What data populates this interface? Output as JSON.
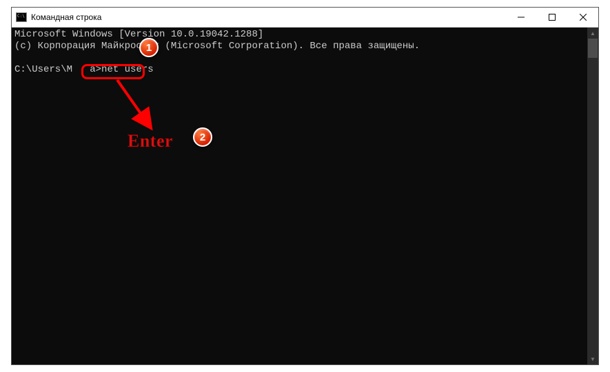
{
  "window": {
    "title": "Командная строка"
  },
  "terminal": {
    "line1": "Microsoft Windows [Version 10.0.19042.1288]",
    "line2": "(c) Корпорация Майкрософт (Microsoft Corporation). Все права защищены.",
    "blank": "",
    "prompt_prefix": "C:\\Users\\M",
    "prompt_mask": "   ",
    "prompt_suffix": "a>",
    "command": "net users"
  },
  "annotations": {
    "badge1": "1",
    "badge2": "2",
    "enter_label": "Enter"
  }
}
